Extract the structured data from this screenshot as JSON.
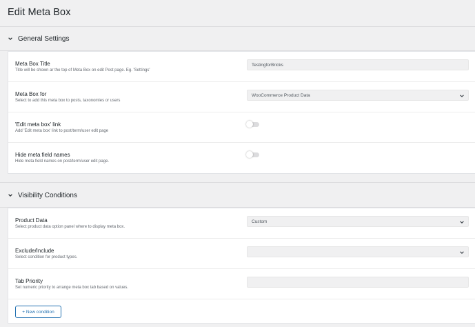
{
  "page": {
    "title": "Edit Meta Box"
  },
  "sections": [
    {
      "title": "General Settings",
      "rows": [
        {
          "label": "Meta Box Title",
          "desc": "Title will be shown ar the top of Meta Box on edit Post page. Eg. 'Settings'",
          "control": "input",
          "value": "TestingforBricks"
        },
        {
          "label": "Meta Box for",
          "desc": "Select to add this meta box to posts, taxonomies or users",
          "control": "select",
          "value": "WooCommerce Product Data"
        },
        {
          "label": "'Edit meta box' link",
          "desc": "Add 'Edit meta box' link to post/term/user edit page",
          "control": "toggle",
          "value": "off"
        },
        {
          "label": "Hide meta field names",
          "desc": "Hide meta field names on post/term/user edit page.",
          "control": "toggle",
          "value": "off"
        }
      ]
    },
    {
      "title": "Visibility Conditions",
      "rows": [
        {
          "label": "Product Data",
          "desc": "Select product data option panel where to display meta box.",
          "control": "select",
          "value": "Custom"
        },
        {
          "label": "Exclude/Include",
          "desc": "Select condition for product types.",
          "control": "select",
          "value": ""
        },
        {
          "label": "Tab Priority",
          "desc": "Set numeric priority to arrange meta box tab based on values.",
          "control": "input",
          "value": ""
        }
      ],
      "button": "+ New condition"
    }
  ],
  "icons": {
    "section_toggle": "chevron-down-icon",
    "select_caret": "chevron-down-icon"
  },
  "colors": {
    "accent": "#2271b1",
    "background": "#f0f0f1",
    "card": "#ffffff"
  }
}
